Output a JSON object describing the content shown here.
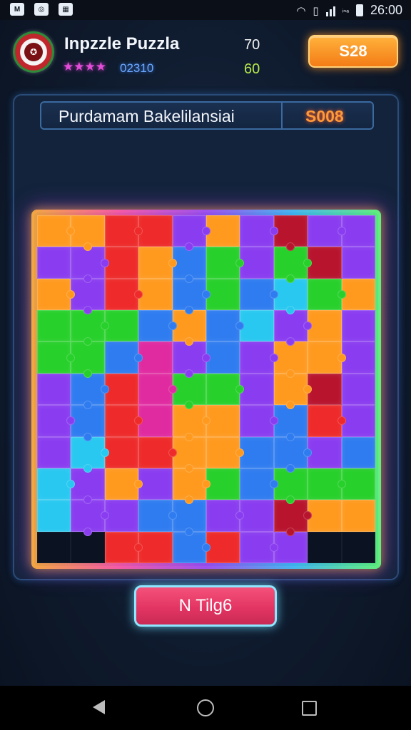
{
  "header": {
    "title": "Inpzzle Puzzla",
    "stars": "★★★★",
    "timer": "02310",
    "score_top": "70",
    "score_bottom": "60",
    "coin_button_label": "S28"
  },
  "status_bar": {
    "time": "26:00",
    "network_label": "ᵢₙₐ"
  },
  "panel": {
    "title": "Purdamam Bakelilansiai",
    "score": "S008"
  },
  "action_button": {
    "label": "N Tilg6"
  },
  "colors": {
    "accent_orange": "#f47c16",
    "accent_pink": "#e33563",
    "glow_cyan": "#8fe6ff"
  },
  "board": {
    "palette": {
      "O": "#ff9a1f",
      "R": "#ee2a2a",
      "P": "#8a3df0",
      "G": "#27d02b",
      "B": "#2f7cf0",
      "C": "#28c8f0",
      "M": "#e02aa0",
      "D": "#b8142e",
      "X": "empty"
    },
    "rows": [
      "OORRPOPDPP",
      "PPROBGPGDP",
      "OPROBGBCGO",
      "GGGBOBCPOP",
      "GGBMPBPOOP",
      "PBRMGGPODP",
      "PBRMOOPBRP",
      "PCRROOBBPB",
      "CPOPOGBGGG",
      "CPPBBPPDOO",
      "XXRRBRPPXX"
    ]
  }
}
